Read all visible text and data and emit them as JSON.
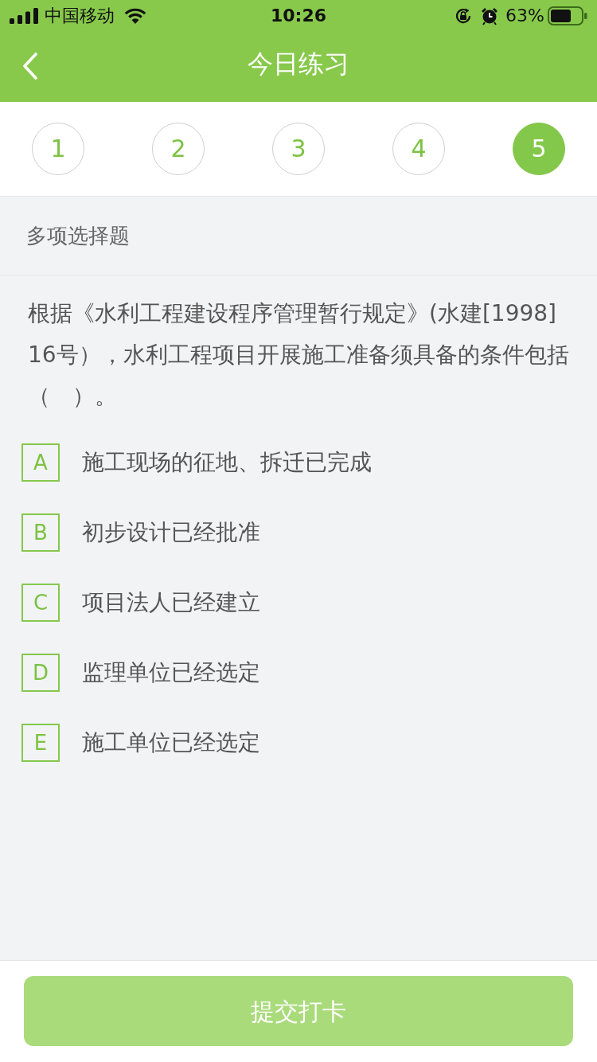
{
  "status_bar": {
    "carrier": "中国移动",
    "time": "10:26",
    "battery": "63%"
  },
  "nav_bar": {
    "title": "今日练习"
  },
  "question_nav": [
    {
      "label": "1",
      "selected": false
    },
    {
      "label": "2",
      "selected": false
    },
    {
      "label": "3",
      "selected": false
    },
    {
      "label": "4",
      "selected": false
    },
    {
      "label": "5",
      "selected": true
    }
  ],
  "section": {
    "title": "多项选择题"
  },
  "question": {
    "text": "根据《水利工程建设程序管理暂行规定》(水建[1998] 16号），水利工程项目开展施工准备须具备的条件包括（　）。",
    "options": [
      {
        "letter": "A",
        "text": "施工现场的征地、拆迁已完成",
        "selected": false
      },
      {
        "letter": "B",
        "text": "初步设计已经批准",
        "selected": false
      },
      {
        "letter": "C",
        "text": "项目法人已经建立",
        "selected": false
      },
      {
        "letter": "D",
        "text": "监理单位已经选定",
        "selected": false
      },
      {
        "letter": "E",
        "text": "施工单位已经选定",
        "selected": false
      }
    ]
  },
  "submit_button": {
    "label": "提交打卡",
    "disabled": true
  }
}
